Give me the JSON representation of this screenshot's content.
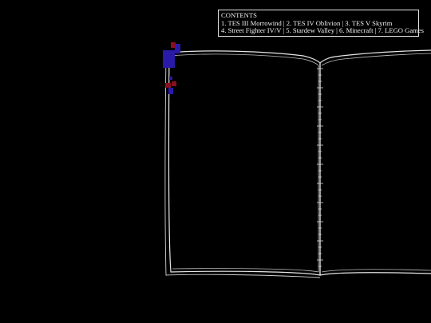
{
  "contents": {
    "heading": "CONTENTS",
    "line1": "1. TES III Morrowind | 2. TES IV Oblivion | 3. TES V Skyrim",
    "line2": "4. Street Fighter IV/V | 5. Stardew Valley | 6. Minecraft | 7. LEGO Games"
  },
  "colors": {
    "background": "#000000",
    "book_outline": "#e6e6e6",
    "bookmark_blue": "#2a1aa8",
    "bookmark_red": "#8a1020"
  },
  "book": {
    "state": "open, blank pages",
    "spine_stitches": "hatched tick marks"
  }
}
